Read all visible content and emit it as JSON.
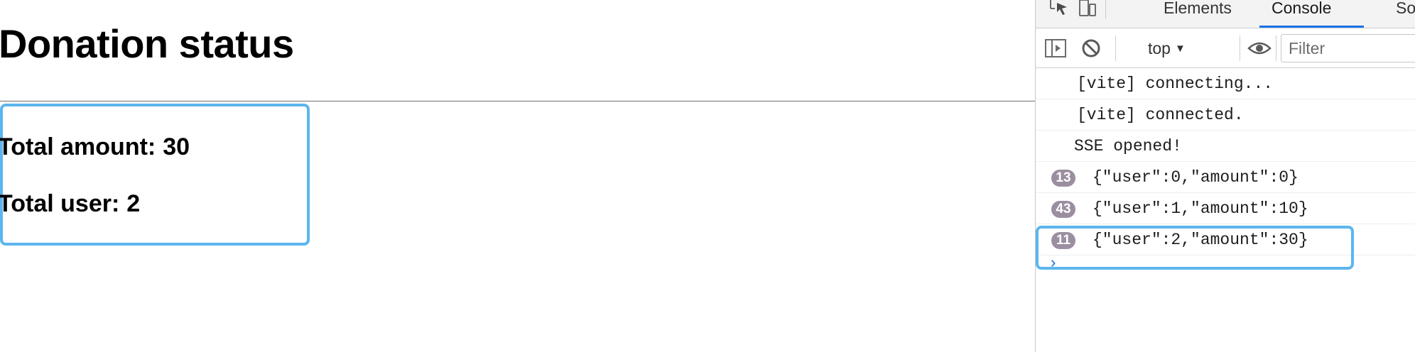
{
  "page": {
    "title": "Donation status",
    "stats": {
      "amount_label": "Total amount:",
      "amount_value": "30",
      "user_label": "Total user:",
      "user_value": "2"
    },
    "highlight_color": "#5bb6ee"
  },
  "devtools": {
    "tabs": [
      {
        "label": "Elements",
        "active": false
      },
      {
        "label": "Console",
        "active": true
      },
      {
        "label": "Sou",
        "active": false
      }
    ],
    "toolbar": {
      "context": "top",
      "filter_placeholder": "Filter"
    },
    "icons": [
      "inspect-icon",
      "device-toggle-icon",
      "sidebar-toggle-icon",
      "clear-console-icon",
      "eye-icon",
      "caret-down-icon"
    ],
    "console_lines": [
      {
        "count": "",
        "text": "[vite] connecting..."
      },
      {
        "count": "",
        "text": "[vite] connected."
      },
      {
        "count": "",
        "text": "SSE opened!"
      },
      {
        "count": "13",
        "text": "{\"user\":0,\"amount\":0}"
      },
      {
        "count": "43",
        "text": "{\"user\":1,\"amount\":10}"
      },
      {
        "count": "11",
        "text": "{\"user\":2,\"amount\":30}"
      }
    ],
    "prompt_symbol": "›",
    "accent_color": "#1a73e8"
  }
}
